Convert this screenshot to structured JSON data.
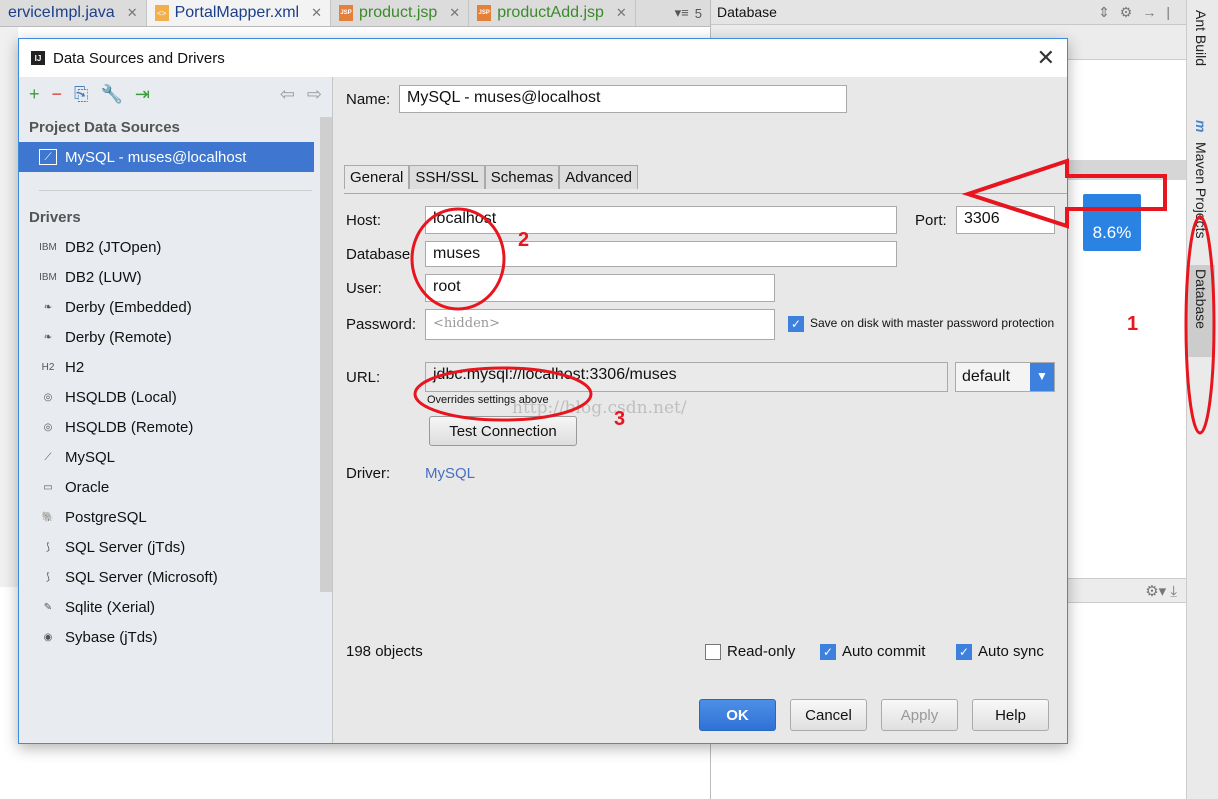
{
  "editor_tabs": [
    {
      "label": "erviceImpl.java",
      "icon": "java"
    },
    {
      "label": "PortalMapper.xml",
      "icon": "xml"
    },
    {
      "label": "product.jsp",
      "icon": "JSP"
    },
    {
      "label": "productAdd.jsp",
      "icon": "JSP"
    }
  ],
  "tab_overflow": "5",
  "db_panel": {
    "title": "Database",
    "progress_label": "8.6%"
  },
  "side_tools": [
    "Ant Build",
    "Maven Projects",
    "Database"
  ],
  "dialog": {
    "title": "Data Sources and Drivers",
    "icon_text": "IJ",
    "project_section": "Project Data Sources",
    "project_items": [
      "MySQL - muses@localhost"
    ],
    "drivers_section": "Drivers",
    "drivers": [
      {
        "label": "DB2 (JTOpen)",
        "icon": "IBM"
      },
      {
        "label": "DB2 (LUW)",
        "icon": "IBM"
      },
      {
        "label": "Derby (Embedded)",
        "icon": "feather"
      },
      {
        "label": "Derby (Remote)",
        "icon": "feather"
      },
      {
        "label": "H2",
        "icon": "H2"
      },
      {
        "label": "HSQLDB (Local)",
        "icon": "hsql"
      },
      {
        "label": "HSQLDB (Remote)",
        "icon": "hsql"
      },
      {
        "label": "MySQL",
        "icon": "mysql"
      },
      {
        "label": "Oracle",
        "icon": "oracle"
      },
      {
        "label": "PostgreSQL",
        "icon": "elephant"
      },
      {
        "label": "SQL Server (jTds)",
        "icon": "sqlserver"
      },
      {
        "label": "SQL Server (Microsoft)",
        "icon": "sqlserver"
      },
      {
        "label": "Sqlite (Xerial)",
        "icon": "sqlite"
      },
      {
        "label": "Sybase (jTds)",
        "icon": "sybase"
      }
    ],
    "name_label": "Name:",
    "name_value": "MySQL - muses@localhost",
    "tabs": [
      "General",
      "SSH/SSL",
      "Schemas",
      "Advanced"
    ],
    "host_label": "Host:",
    "host_value": "localhost",
    "port_label": "Port:",
    "port_value": "3306",
    "database_label": "Database:",
    "database_value": "muses",
    "user_label": "User:",
    "user_value": "root",
    "password_label": "Password:",
    "password_placeholder": "<hidden>",
    "save_on_disk": "Save on disk with master password protection",
    "url_label": "URL:",
    "url_value": "jdbc:mysql://localhost:3306/muses",
    "url_mode": "default",
    "url_hint": "Overrides settings above",
    "test_connection": "Test Connection",
    "driver_label": "Driver:",
    "driver_value": "MySQL",
    "objects_count": "198 objects",
    "read_only": "Read-only",
    "auto_commit": "Auto commit",
    "auto_sync": "Auto sync",
    "buttons": {
      "ok": "OK",
      "cancel": "Cancel",
      "apply": "Apply",
      "help": "Help"
    }
  },
  "annotations": {
    "n1": "1",
    "n2": "2",
    "n3": "3",
    "watermark": "http://blog.csdn.net/"
  },
  "colors": {
    "accent": "#3d80de",
    "annotation": "#e8141e"
  }
}
